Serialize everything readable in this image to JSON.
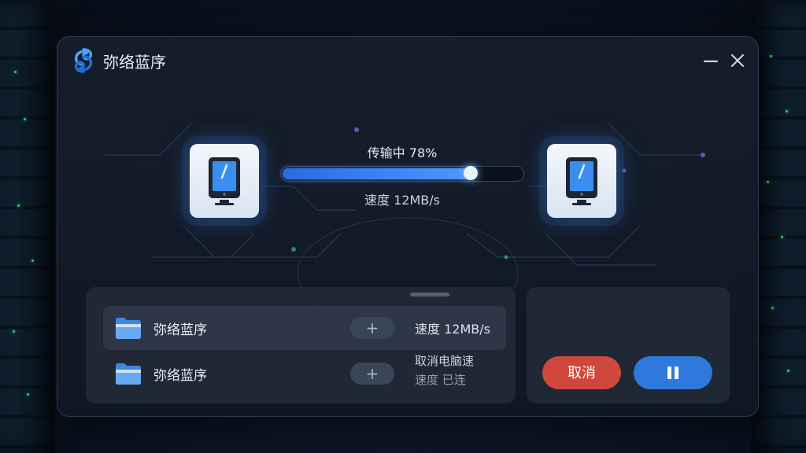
{
  "app": {
    "title": "弥络蓝序",
    "logo_icon": "swirl-logo-icon"
  },
  "window_controls": {
    "minimize_icon": "minimize-icon",
    "close_icon": "close-icon"
  },
  "transfer": {
    "status_text": "传输中 78%",
    "progress": 0.78,
    "speed_text": "速度 12MB/s",
    "source_device_icon": "tablet-icon",
    "target_device_icon": "tablet-icon"
  },
  "files": [
    {
      "name": "弥络蓝序",
      "icon": "folder-icon",
      "add_label": "+",
      "info": "速度 12MB/s",
      "info_sub": ""
    },
    {
      "name": "弥络蓝序",
      "icon": "folder-icon",
      "add_label": "+",
      "info": "取消电脑速",
      "info_sub": "速度 已连"
    }
  ],
  "actions": {
    "cancel_label": "取消",
    "pause_icon": "pause-icon"
  },
  "colors": {
    "accent_blue": "#2f79dd",
    "cancel_red": "#d0483c",
    "progress_fill": "#4f98ff"
  }
}
